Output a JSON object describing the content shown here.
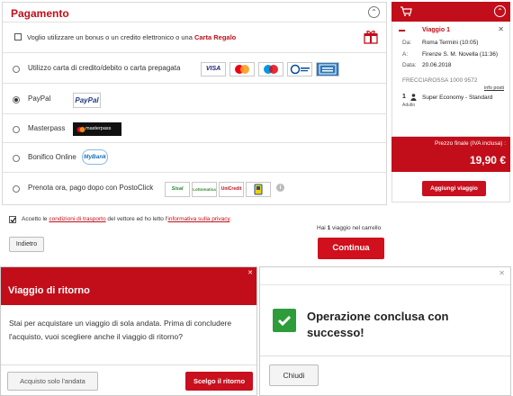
{
  "payment": {
    "title": "Pagamento",
    "bonus_prefix": "Voglio utilizzare un bonus o un credito elettronico o una",
    "bonus_link": "Carta Regalo",
    "options": [
      {
        "label": "Utilizzo carta di credito/debito o carta prepagata",
        "selected": false,
        "logos": [
          "VISA",
          "Mastercard",
          "Maestro",
          "Diners Club",
          "American Express"
        ]
      },
      {
        "label": "PayPal",
        "selected": true,
        "logos": [
          "PayPal"
        ]
      },
      {
        "label": "Masterpass",
        "selected": false,
        "logos": [
          "masterpass"
        ]
      },
      {
        "label": "Bonifico Online",
        "selected": false,
        "logos": [
          "MyBank"
        ]
      },
      {
        "label": "Prenota ora, pago dopo con PostoClick",
        "selected": false,
        "logos": [
          "Sisal",
          "Lottomatica",
          "UniCredit",
          "Posta"
        ]
      }
    ]
  },
  "terms": {
    "checked": true,
    "prefix": "Accetto le",
    "link1": "condizioni di trasporto",
    "middle": "del vettore ed ho letto l'",
    "link2": "informativa sulla privacy",
    "suffix": "."
  },
  "cart_note": {
    "prefix": "Hai",
    "count": "1",
    "suffix": "viaggio nel carrello"
  },
  "buttons": {
    "back": "Indietro",
    "continue": "Continua"
  },
  "trip": {
    "title": "Viaggio 1",
    "from_label": "Da:",
    "from": "Roma Termini (10:05)",
    "to_label": "A:",
    "to": "Firenze S. M. Novella (11:36)",
    "date_label": "Data:",
    "date": "20.06.2018",
    "train": "FRECCIAROSSA 1000  9572",
    "info_link": "info posti",
    "passenger_count": "1",
    "passenger_type": "Adulto",
    "fare": "Super Economy  -  Standard"
  },
  "price": {
    "label": "Prezzo finale (IVA inclusa) :",
    "value": "19,90 €"
  },
  "add_trip": "Aggiungi viaggio",
  "return_modal": {
    "title": "Viaggio di ritorno",
    "body": "Stai per acquistare un viaggio di sola andata. Prima di concludere l'acquisto, vuoi scegliere anche il viaggio di ritorno?",
    "one_way": "Acquisto solo l'andata",
    "choose_return": "Scelgo il ritorno"
  },
  "success_modal": {
    "message": "Operazione conclusa con successo!",
    "close": "Chiudi"
  },
  "colors": {
    "brand_red": "#c20e1a",
    "success_green": "#2e9c3a"
  }
}
